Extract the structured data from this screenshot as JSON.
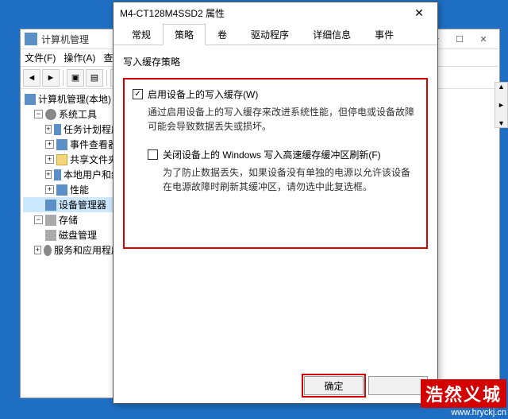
{
  "mgmt": {
    "title": "计算机管理",
    "menu": {
      "file": "文件(F)",
      "action": "操作(A)",
      "view": "查",
      "help": ""
    },
    "tree": {
      "root": "计算机管理(本地)",
      "systools": "系统工具",
      "scheduler": "任务计划程序",
      "eventviewer": "事件查看器",
      "shared": "共享文件夹",
      "users": "本地用户和组",
      "perf": "性能",
      "devmgr": "设备管理器",
      "storage": "存储",
      "diskmgmt": "磁盘管理",
      "services": "服务和应用程序"
    },
    "winbtns": {
      "min": "─",
      "max": "☐",
      "close": "✕"
    }
  },
  "props": {
    "title": "M4-CT128M4SSD2 属性",
    "close": "✕",
    "tabs": {
      "general": "常规",
      "policies": "策略",
      "volumes": "卷",
      "driver": "驱动程序",
      "details": "详细信息",
      "events": "事件"
    },
    "group_title": "写入缓存策略",
    "check1_label": "启用设备上的写入缓存(W)",
    "check1_desc": "通过启用设备上的写入缓存来改进系统性能，但停电或设备故障可能会导致数据丢失或损坏。",
    "check2_label": "关闭设备上的 Windows 写入高速缓存缓冲区刷新(F)",
    "check2_desc": "为了防止数据丢失，如果设备没有单独的电源以允许该设备在电源故障时刷新其缓冲区，请勿选中此复选框。",
    "ok": "确定",
    "cancel": ""
  },
  "watermark": {
    "brand": "浩然义城",
    "url": "www.hryckj.cn"
  }
}
